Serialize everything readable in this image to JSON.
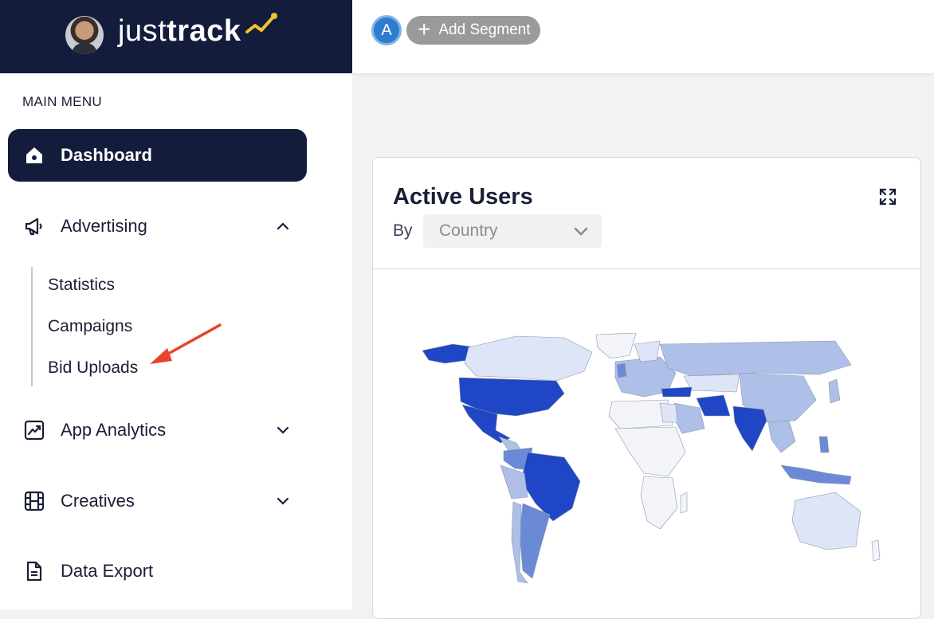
{
  "brand": {
    "logo_regular": "just",
    "logo_bold": "track"
  },
  "sidebar": {
    "menu_title": "MAIN MENU",
    "items": [
      {
        "label": "Dashboard",
        "icon": "home-icon",
        "active": true
      },
      {
        "label": "Advertising",
        "icon": "megaphone-icon",
        "expanded": true,
        "children": [
          "Statistics",
          "Campaigns",
          "Bid Uploads"
        ]
      },
      {
        "label": "App Analytics",
        "icon": "chart-icon",
        "expanded": false
      },
      {
        "label": "Creatives",
        "icon": "film-icon",
        "expanded": false
      },
      {
        "label": "Data Export",
        "icon": "document-icon"
      }
    ]
  },
  "topbar": {
    "segment_letter": "A",
    "add_segment_label": "Add Segment"
  },
  "card": {
    "title": "Active Users",
    "by_label": "By",
    "group_by_value": "Country"
  },
  "colors": {
    "navy": "#131d3b",
    "map_high": "#1f46c4",
    "map_mid": "#6b8ad6",
    "map_low": "#aebfe8",
    "map_lowest": "#dde5f6",
    "annotation_arrow": "#e8442c"
  }
}
